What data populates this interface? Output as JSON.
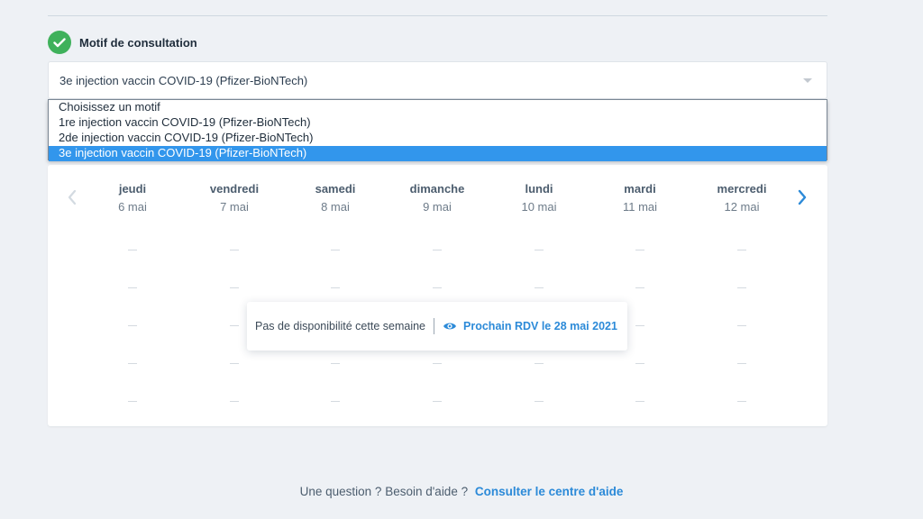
{
  "section": {
    "title": "Motif de consultation"
  },
  "select": {
    "value": "3e injection vaccin COVID-19 (Pfizer-BioNTech)"
  },
  "dropdown": {
    "options": [
      "Choisissez un motif",
      "1re injection vaccin COVID-19 (Pfizer-BioNTech)",
      "2de injection vaccin COVID-19 (Pfizer-BioNTech)",
      "3e injection vaccin COVID-19 (Pfizer-BioNTech)"
    ],
    "selected_index": 3
  },
  "calendar": {
    "days": [
      {
        "name": "jeudi",
        "date": "6 mai"
      },
      {
        "name": "vendredi",
        "date": "7 mai"
      },
      {
        "name": "samedi",
        "date": "8 mai"
      },
      {
        "name": "dimanche",
        "date": "9 mai"
      },
      {
        "name": "lundi",
        "date": "10 mai"
      },
      {
        "name": "mardi",
        "date": "11 mai"
      },
      {
        "name": "mercredi",
        "date": "12 mai"
      }
    ]
  },
  "availability": {
    "message": "Pas de disponibilité cette semaine",
    "next_link": "Prochain RDV le 28 mai 2021"
  },
  "help": {
    "question": "Une question ? Besoin d'aide ?",
    "link": "Consulter le centre d'aide"
  },
  "colors": {
    "accent": "#2c8ad8",
    "success": "#3fb15b",
    "selected_option": "#3296ec"
  },
  "icons": {
    "check": "check-icon",
    "prev": "chevron-left-icon",
    "next": "chevron-right-icon",
    "eye": "eye-icon",
    "caret": "caret-down-icon"
  }
}
